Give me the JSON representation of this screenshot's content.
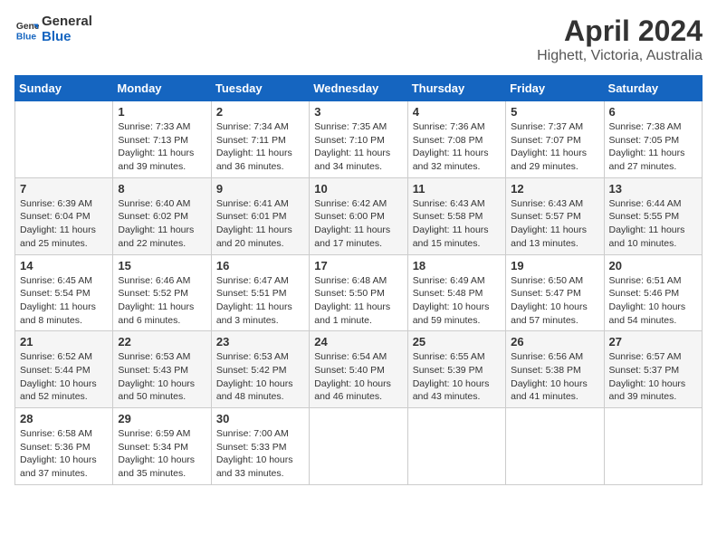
{
  "header": {
    "logo_line1": "General",
    "logo_line2": "Blue",
    "month_title": "April 2024",
    "location": "Highett, Victoria, Australia"
  },
  "days_of_week": [
    "Sunday",
    "Monday",
    "Tuesday",
    "Wednesday",
    "Thursday",
    "Friday",
    "Saturday"
  ],
  "weeks": [
    [
      {
        "day": "",
        "content": ""
      },
      {
        "day": "1",
        "content": "Sunrise: 7:33 AM\nSunset: 7:13 PM\nDaylight: 11 hours\nand 39 minutes."
      },
      {
        "day": "2",
        "content": "Sunrise: 7:34 AM\nSunset: 7:11 PM\nDaylight: 11 hours\nand 36 minutes."
      },
      {
        "day": "3",
        "content": "Sunrise: 7:35 AM\nSunset: 7:10 PM\nDaylight: 11 hours\nand 34 minutes."
      },
      {
        "day": "4",
        "content": "Sunrise: 7:36 AM\nSunset: 7:08 PM\nDaylight: 11 hours\nand 32 minutes."
      },
      {
        "day": "5",
        "content": "Sunrise: 7:37 AM\nSunset: 7:07 PM\nDaylight: 11 hours\nand 29 minutes."
      },
      {
        "day": "6",
        "content": "Sunrise: 7:38 AM\nSunset: 7:05 PM\nDaylight: 11 hours\nand 27 minutes."
      }
    ],
    [
      {
        "day": "7",
        "content": "Sunrise: 6:39 AM\nSunset: 6:04 PM\nDaylight: 11 hours\nand 25 minutes."
      },
      {
        "day": "8",
        "content": "Sunrise: 6:40 AM\nSunset: 6:02 PM\nDaylight: 11 hours\nand 22 minutes."
      },
      {
        "day": "9",
        "content": "Sunrise: 6:41 AM\nSunset: 6:01 PM\nDaylight: 11 hours\nand 20 minutes."
      },
      {
        "day": "10",
        "content": "Sunrise: 6:42 AM\nSunset: 6:00 PM\nDaylight: 11 hours\nand 17 minutes."
      },
      {
        "day": "11",
        "content": "Sunrise: 6:43 AM\nSunset: 5:58 PM\nDaylight: 11 hours\nand 15 minutes."
      },
      {
        "day": "12",
        "content": "Sunrise: 6:43 AM\nSunset: 5:57 PM\nDaylight: 11 hours\nand 13 minutes."
      },
      {
        "day": "13",
        "content": "Sunrise: 6:44 AM\nSunset: 5:55 PM\nDaylight: 11 hours\nand 10 minutes."
      }
    ],
    [
      {
        "day": "14",
        "content": "Sunrise: 6:45 AM\nSunset: 5:54 PM\nDaylight: 11 hours\nand 8 minutes."
      },
      {
        "day": "15",
        "content": "Sunrise: 6:46 AM\nSunset: 5:52 PM\nDaylight: 11 hours\nand 6 minutes."
      },
      {
        "day": "16",
        "content": "Sunrise: 6:47 AM\nSunset: 5:51 PM\nDaylight: 11 hours\nand 3 minutes."
      },
      {
        "day": "17",
        "content": "Sunrise: 6:48 AM\nSunset: 5:50 PM\nDaylight: 11 hours\nand 1 minute."
      },
      {
        "day": "18",
        "content": "Sunrise: 6:49 AM\nSunset: 5:48 PM\nDaylight: 10 hours\nand 59 minutes."
      },
      {
        "day": "19",
        "content": "Sunrise: 6:50 AM\nSunset: 5:47 PM\nDaylight: 10 hours\nand 57 minutes."
      },
      {
        "day": "20",
        "content": "Sunrise: 6:51 AM\nSunset: 5:46 PM\nDaylight: 10 hours\nand 54 minutes."
      }
    ],
    [
      {
        "day": "21",
        "content": "Sunrise: 6:52 AM\nSunset: 5:44 PM\nDaylight: 10 hours\nand 52 minutes."
      },
      {
        "day": "22",
        "content": "Sunrise: 6:53 AM\nSunset: 5:43 PM\nDaylight: 10 hours\nand 50 minutes."
      },
      {
        "day": "23",
        "content": "Sunrise: 6:53 AM\nSunset: 5:42 PM\nDaylight: 10 hours\nand 48 minutes."
      },
      {
        "day": "24",
        "content": "Sunrise: 6:54 AM\nSunset: 5:40 PM\nDaylight: 10 hours\nand 46 minutes."
      },
      {
        "day": "25",
        "content": "Sunrise: 6:55 AM\nSunset: 5:39 PM\nDaylight: 10 hours\nand 43 minutes."
      },
      {
        "day": "26",
        "content": "Sunrise: 6:56 AM\nSunset: 5:38 PM\nDaylight: 10 hours\nand 41 minutes."
      },
      {
        "day": "27",
        "content": "Sunrise: 6:57 AM\nSunset: 5:37 PM\nDaylight: 10 hours\nand 39 minutes."
      }
    ],
    [
      {
        "day": "28",
        "content": "Sunrise: 6:58 AM\nSunset: 5:36 PM\nDaylight: 10 hours\nand 37 minutes."
      },
      {
        "day": "29",
        "content": "Sunrise: 6:59 AM\nSunset: 5:34 PM\nDaylight: 10 hours\nand 35 minutes."
      },
      {
        "day": "30",
        "content": "Sunrise: 7:00 AM\nSunset: 5:33 PM\nDaylight: 10 hours\nand 33 minutes."
      },
      {
        "day": "",
        "content": ""
      },
      {
        "day": "",
        "content": ""
      },
      {
        "day": "",
        "content": ""
      },
      {
        "day": "",
        "content": ""
      }
    ]
  ]
}
